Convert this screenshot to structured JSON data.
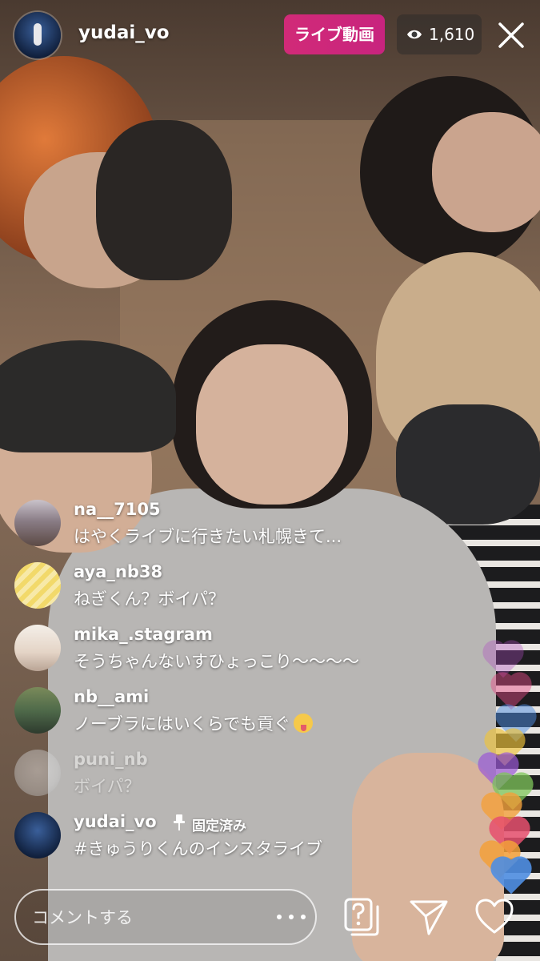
{
  "header": {
    "username": "yudai_vo",
    "live_label": "ライブ動画",
    "viewer_count": "1,610",
    "viewer_icon": "eye-icon",
    "close_icon": "close-icon",
    "live_color": "#c8247e"
  },
  "comments": [
    {
      "username": "na__7105",
      "text": "はやくライブに行きたい札幌きて..."
    },
    {
      "username": "aya_nb38",
      "text": "ねぎくん？ボイパ？"
    },
    {
      "username": "mika_.stagram",
      "text": "そうちゃんないすひょっこり〜〜〜〜"
    },
    {
      "username": "nb__ami",
      "text": "ノーブラにはいくらでも貢ぐ",
      "emoji": "zany-face-emoji"
    },
    {
      "username": "puni_nb",
      "text": "ボイパ？"
    }
  ],
  "pinned_comment": {
    "username": "yudai_vo",
    "pinned_label": "固定済み",
    "pin_icon": "pin-icon",
    "text": "#きゅうりくんのインスタライブ"
  },
  "composer": {
    "placeholder": "コメントする",
    "more_icon": "more-options-icon",
    "question_icon": "question-icon",
    "share_icon": "send-icon",
    "like_icon": "heart-icon"
  },
  "hearts_colors": [
    "#b14fc5",
    "#e94c89",
    "#f4a13b",
    "#f0c43a",
    "#7fc65a",
    "#4f8fe3",
    "#9b59d6",
    "#e7506f"
  ]
}
